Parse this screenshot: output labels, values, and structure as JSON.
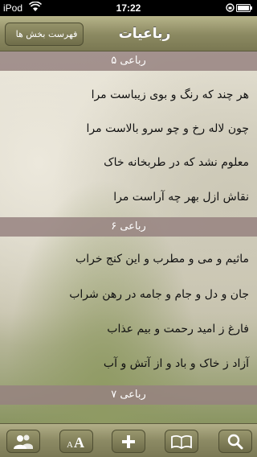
{
  "status_bar": {
    "carrier": "iPod",
    "time": "17:22"
  },
  "nav": {
    "back_label": "فهرست بخش ها",
    "title": "رباعیات"
  },
  "sections": [
    {
      "header": "رباعی ۵",
      "lines": [
        "هر چند که رنگ و بوی زیباست مرا",
        "چون لاله رخ و چو سرو بالاست مرا",
        "معلوم نشد که در طربخانه خاک",
        "نقاش ازل بهر چه آراست مرا"
      ]
    },
    {
      "header": "رباعی ۶",
      "lines": [
        "ماثیم و می و مطرب و این کنج خراب",
        "جان و دل و جام و جامه در رهن شراب",
        "فارغ ز امید رحمت و بیم عذاب",
        "آزاد ز خاک و باد و از آتش و آب"
      ]
    },
    {
      "header": "رباعی ۷",
      "lines": []
    }
  ],
  "toolbar": {
    "buttons": [
      {
        "icon": "people-icon"
      },
      {
        "icon": "font-size-icon",
        "label": "AA"
      },
      {
        "icon": "plus-icon"
      },
      {
        "icon": "book-icon"
      },
      {
        "icon": "search-icon"
      }
    ]
  }
}
